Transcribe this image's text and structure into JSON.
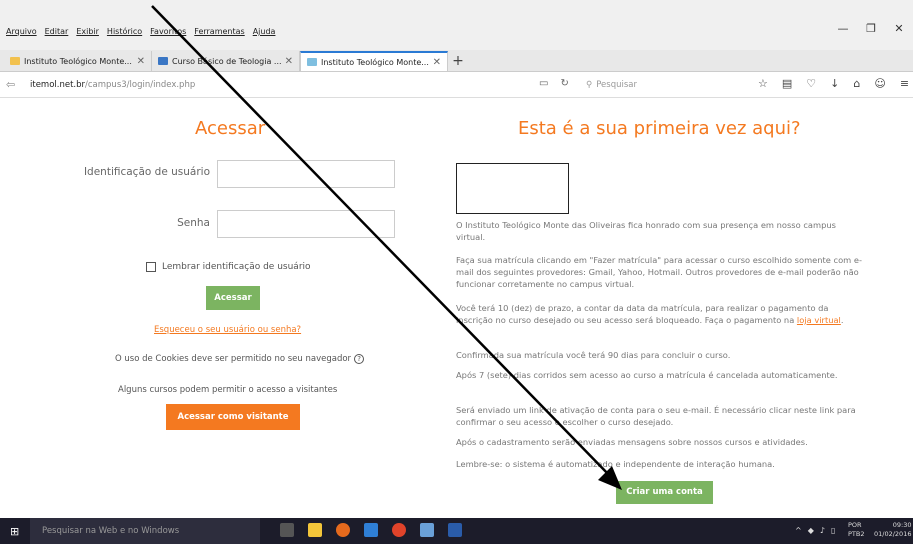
{
  "browser": {
    "menu": [
      "Arquivo",
      "Editar",
      "Exibir",
      "Histórico",
      "Favoritos",
      "Ferramentas",
      "Ajuda"
    ],
    "window_controls": [
      "—",
      "❐",
      "✕"
    ],
    "tabs": [
      {
        "title": "Instituto Teológico Monte...",
        "close": "✕"
      },
      {
        "title": "Curso Básico de Teologia ...",
        "close": "✕"
      },
      {
        "title": "Instituto Teológico Monte...",
        "close": "✕"
      }
    ],
    "new_tab": "+",
    "url_host": "itemol.net.br",
    "url_path": "/campus3/login/index.php",
    "search_placeholder": "Pesquisar"
  },
  "login": {
    "heading": "Acessar",
    "username_label": "Identificação de usuário",
    "password_label": "Senha",
    "remember_label": "Lembrar identificação de usuário",
    "submit_label": "Acessar",
    "forgot_link": "Esqueceu o seu usuário ou senha?",
    "cookies_text": "O uso de Cookies deve ser permitido no seu navegador",
    "help_icon": "?",
    "guests_text": "Alguns cursos podem permitir o acesso a visitantes",
    "guest_button": "Acessar como visitante"
  },
  "signup": {
    "heading": "Esta é a sua primeira vez aqui?",
    "p1": "O Instituto Teológico Monte das Oliveiras fica honrado com sua presença em nosso campus virtual.",
    "p2": "Faça sua matrícula clicando em \"Fazer matrícula\" para acessar o curso escolhido somente com e-mail dos seguintes provedores: Gmail, Yahoo, Hotmail. Outros provedores de e-mail poderão não funcionar corretamente no campus virtual.",
    "p3_before": "Você terá 10 (dez) de prazo, a contar da data da matrícula, para realizar o pagamento da inscrição no curso desejado ou seu acesso será bloqueado. Faça o pagamento na ",
    "p3_link": "loja virtual",
    "p3_after": ".",
    "p4": "Confirmada sua matrícula você terá 90 dias para concluir o curso.",
    "p5": "Após 7 (sete) dias corridos sem acesso ao curso a matrícula é cancelada automaticamente.",
    "p6": "Será enviado um link de ativação de conta para o seu e-mail. É necessário clicar neste link para confirmar o seu acesso e escolher o curso desejado.",
    "p7": "Após o cadastramento serão enviadas mensagens sobre nossos cursos e atividades.",
    "p8": "Lembre-se: o sistema é automatizado e independente de interação humana.",
    "create_button": "Criar uma conta"
  },
  "taskbar": {
    "search_placeholder": "Pesquisar na Web e no Windows",
    "lang_top": "POR",
    "lang_bottom": "PTB2",
    "time": "09:30",
    "date": "01/02/2016"
  },
  "colors": {
    "accent": "#f47920",
    "green": "#7cb461"
  }
}
